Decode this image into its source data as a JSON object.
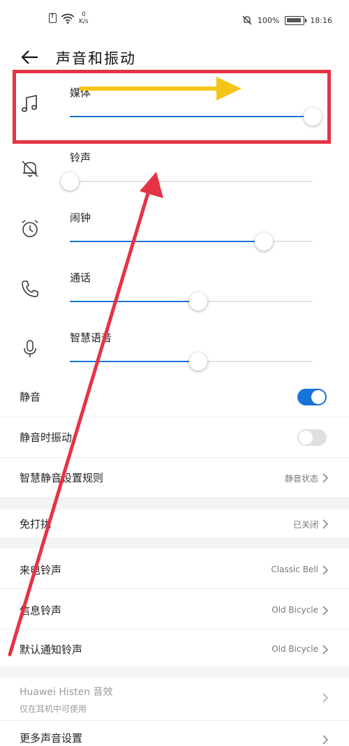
{
  "status_bar": {
    "speed_value": "0",
    "speed_unit": "K/s",
    "battery": "100%",
    "time": "18:16"
  },
  "header": {
    "title": "声音和振动"
  },
  "volumes": [
    {
      "label": "媒体",
      "icon": "music-note-icon",
      "level": 1.0
    },
    {
      "label": "铃声",
      "icon": "bell-off-icon",
      "level": 0.0
    },
    {
      "label": "闹钟",
      "icon": "alarm-clock-icon",
      "level": 0.8
    },
    {
      "label": "通话",
      "icon": "phone-icon",
      "level": 0.53
    },
    {
      "label": "智慧语音",
      "icon": "microphone-icon",
      "level": 0.53
    }
  ],
  "toggles": [
    {
      "label": "静音",
      "on": true
    },
    {
      "label": "静音时振动",
      "on": false
    }
  ],
  "links": {
    "mute_schedule": {
      "label": "智慧静音设置规则",
      "value": "静音状态"
    },
    "do_not_disturb": {
      "label": "免打扰",
      "value": "已关闭"
    },
    "ringtone": {
      "label": "来电铃声",
      "value": "Classic Bell"
    },
    "notification": {
      "label": "信息铃声",
      "value": "Old Bicycle"
    },
    "default_notification": {
      "label": "默认通知铃声",
      "value": "Old Bicycle"
    },
    "histen": {
      "label": "Huawei Histen 音效",
      "sub": "仅在耳机中可使用"
    },
    "more": {
      "label": "更多声音设置"
    }
  },
  "colors": {
    "accent": "#1a73d9",
    "annotation_red": "#e53344",
    "annotation_yellow": "#f5c518"
  }
}
